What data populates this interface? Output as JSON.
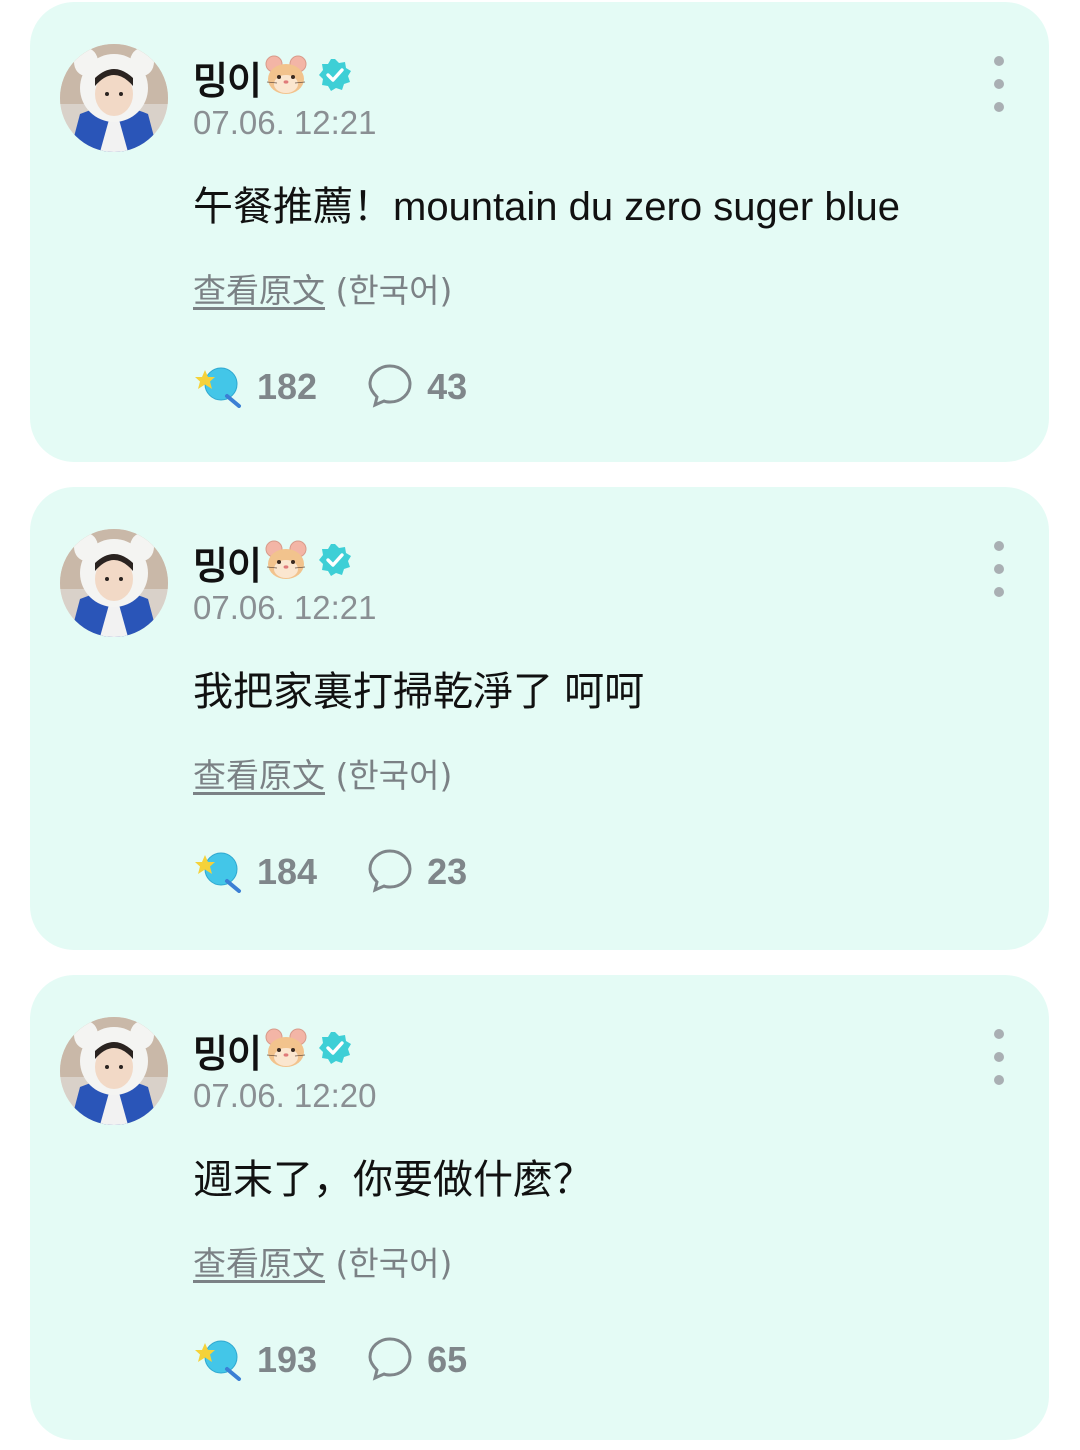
{
  "posts": [
    {
      "author": "밍이",
      "time": "07.06. 12:21",
      "text": "午餐推薦！mountain du zero suger blue",
      "translate_link": "查看原文",
      "translate_lang": "(한국어)",
      "likes": "182",
      "comments": "43"
    },
    {
      "author": "밍이",
      "time": "07.06. 12:21",
      "text": "我把家裏打掃乾淨了 呵呵",
      "translate_link": "查看原文",
      "translate_lang": "(한국어)",
      "likes": "184",
      "comments": "23"
    },
    {
      "author": "밍이",
      "time": "07.06. 12:20",
      "text": "週末了，你要做什麼？",
      "translate_link": "查看原文",
      "translate_lang": "(한국어)",
      "likes": "193",
      "comments": "65"
    }
  ],
  "icons": {
    "author_badge": "hamster-face-icon",
    "verified": "verified-check-icon",
    "like": "star-planet-like-icon",
    "comment": "speech-bubble-icon",
    "more": "vertical-dots-icon"
  },
  "colors": {
    "card_background": "#e4fbf5",
    "verified": "#3ecfd6",
    "like_icon": "#3ac2e0",
    "muted_text": "#8a8f93"
  }
}
